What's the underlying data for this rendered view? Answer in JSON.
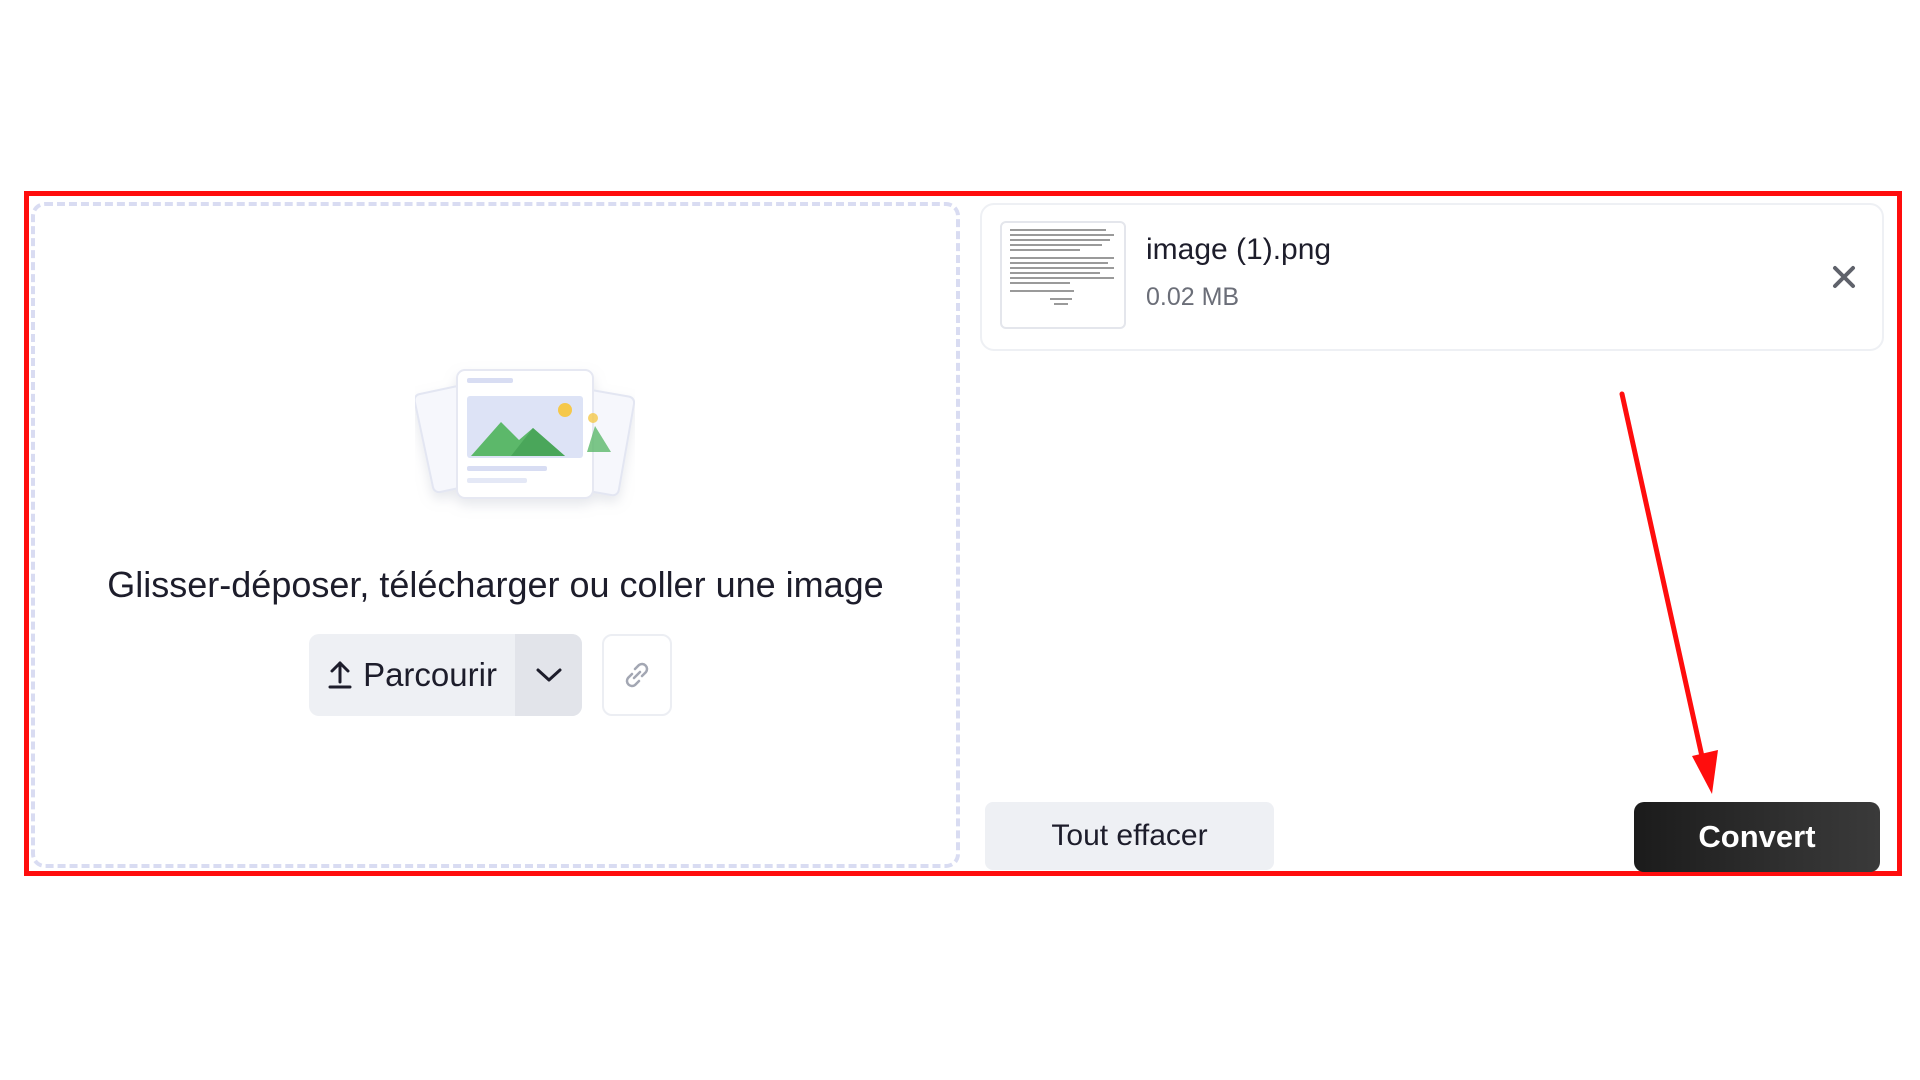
{
  "dropzone": {
    "prompt": "Glisser-déposer, télécharger ou coller une image",
    "browse_label": "Parcourir",
    "upload_icon": "upload-icon",
    "dropdown_icon": "chevron-down-icon",
    "link_icon": "link-icon"
  },
  "file": {
    "name": "image (1).png",
    "size": "0.02 MB",
    "remove_icon": "close-icon"
  },
  "actions": {
    "clear_label": "Tout effacer",
    "convert_label": "Convert"
  },
  "colors": {
    "highlight": "#ff0d0d",
    "annotation_arrow": "#ff0d0d",
    "convert_bg": "#1b1b1b",
    "secondary_bg": "#eef0f4"
  }
}
